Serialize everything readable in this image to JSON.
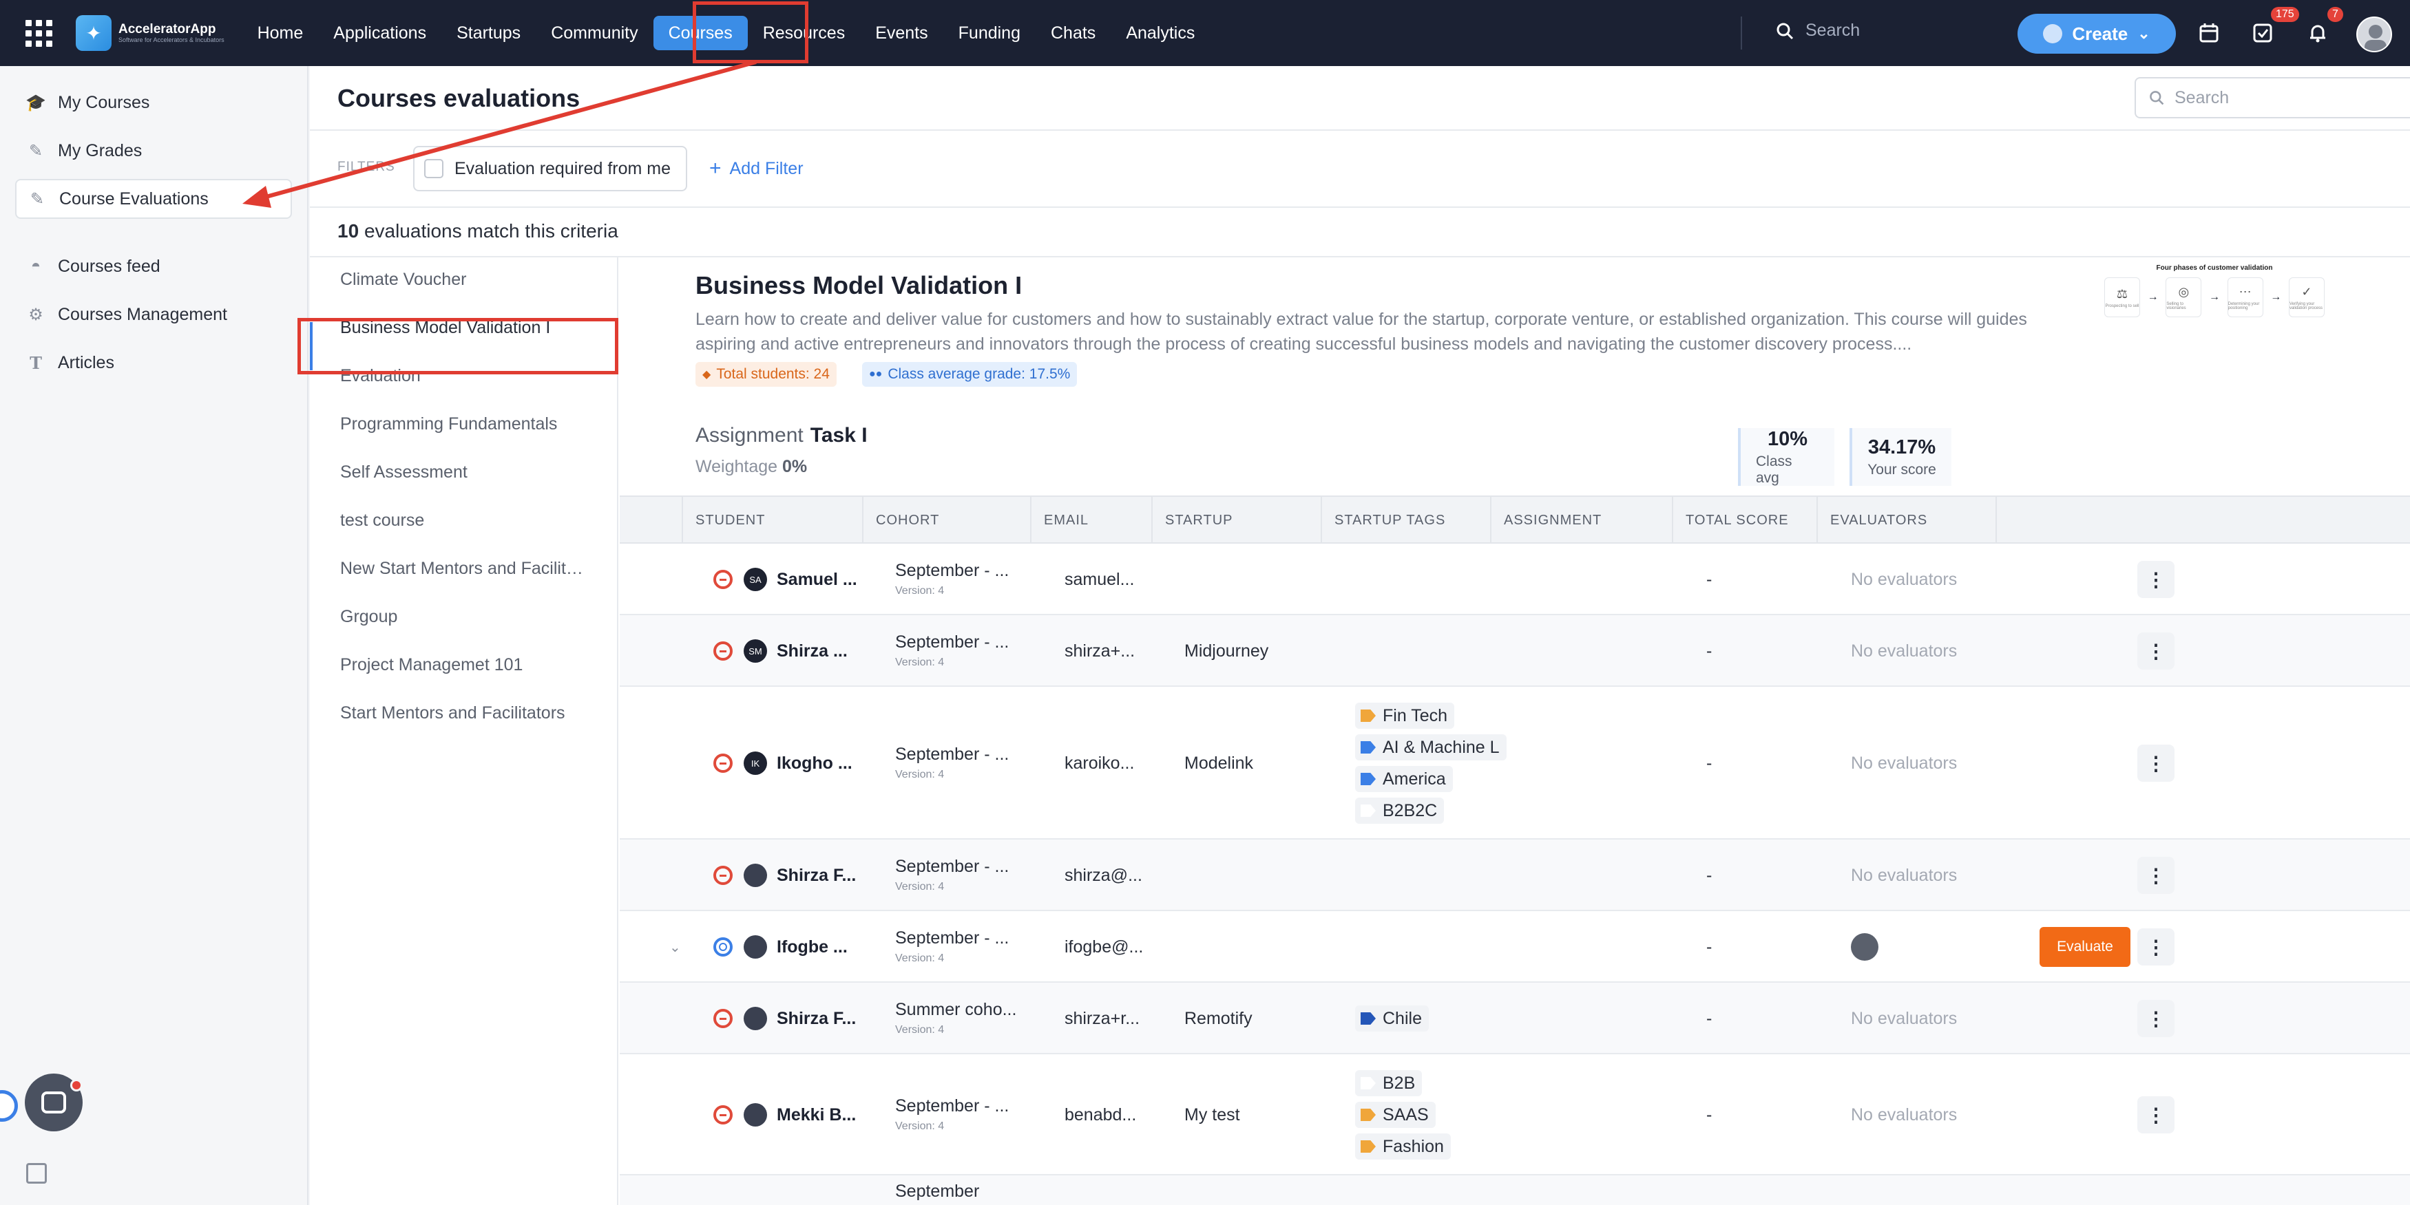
{
  "topbar": {
    "logo_name": "AcceleratorApp",
    "logo_sub": "Software for Accelerators & Incubators",
    "nav": [
      "Home",
      "Applications",
      "Startups",
      "Community",
      "Courses",
      "Resources",
      "Events",
      "Funding",
      "Chats",
      "Analytics"
    ],
    "active_nav": "Courses",
    "search_placeholder": "Search",
    "create_label": "Create",
    "tasks_badge": "175",
    "notifications_badge": "7"
  },
  "sidebar": {
    "items": [
      {
        "label": "My Courses",
        "icon": "courses-icon"
      },
      {
        "label": "My Grades",
        "icon": "grades-icon"
      },
      {
        "label": "Course Evaluations",
        "icon": "evaluations-icon"
      },
      {
        "label": "Courses feed",
        "icon": "feed-icon"
      },
      {
        "label": "Courses Management",
        "icon": "gear-icon"
      },
      {
        "label": "Articles",
        "icon": "text-icon"
      }
    ],
    "selected": "Course Evaluations"
  },
  "main": {
    "title": "Courses evaluations",
    "search_placeholder": "Search",
    "filters_label": "FILTERS",
    "filter_chip": "Evaluation required from me",
    "add_filter": "Add Filter",
    "match_count": "10",
    "match_text": "evaluations match this criteria"
  },
  "courses": [
    "Climate Voucher",
    "Business Model Validation I",
    "Evaluation",
    "Programming Fundamentals",
    "Self Assessment",
    "test course",
    "New Start Mentors and Facilitators",
    "Grgoup",
    "Project Managemet 101",
    "Start Mentors and Facilitators"
  ],
  "course": {
    "title": "Business Model Validation I",
    "description": "Learn how to create and deliver value for customers and how to sustainably extract value for the startup, corporate venture, or established organization. This course will guides aspiring and active entrepreneurs and innovators through the process of creating successful business models and navigating the customer discovery process....",
    "total_students": "Total students: 24",
    "class_avg_grade": "Class average grade: 17.5%",
    "thumb_title": "Four phases of customer validation",
    "thumb_steps": [
      "Prospecting to sell",
      "Selling to visionaries",
      "Determining your positioning",
      "Verifying your validation process"
    ]
  },
  "assignment": {
    "label": "Assignment",
    "name": "Task I",
    "weightage_label": "Weightage",
    "weightage": "0%",
    "class_avg": "10%",
    "class_avg_label": "Class avg",
    "your_score": "34.17%",
    "your_score_label": "Your score"
  },
  "table": {
    "headers": [
      "STUDENT",
      "COHORT",
      "EMAIL",
      "STARTUP",
      "STARTUP TAGS",
      "ASSIGNMENT",
      "TOTAL SCORE",
      "EVALUATORS"
    ],
    "no_evaluators": "No evaluators",
    "evaluate_label": "Evaluate",
    "rows": [
      {
        "initials": "SA",
        "name": "Samuel ...",
        "cohort": "September - ...",
        "version": "Version: 4",
        "email": "samuel...",
        "startup": "",
        "tags": [],
        "score": "-",
        "evaluators": "No evaluators",
        "status": "red"
      },
      {
        "initials": "SM",
        "name": "Shirza ...",
        "cohort": "September - ...",
        "version": "Version: 4",
        "email": "shirza+...",
        "startup": "Midjourney",
        "tags": [],
        "score": "-",
        "evaluators": "No evaluators",
        "status": "red"
      },
      {
        "initials": "IK",
        "name": "Ikogho ...",
        "cohort": "September - ...",
        "version": "Version: 4",
        "email": "karoiko...",
        "startup": "Modelink",
        "tags": [
          {
            "label": "Fin Tech",
            "color": "#f0a63a"
          },
          {
            "label": "AI & Machine L",
            "color": "#3b7fe6"
          },
          {
            "label": "America",
            "color": "#3b7fe6"
          },
          {
            "label": "B2B2C",
            "color": "#ffffff"
          }
        ],
        "score": "-",
        "evaluators": "No evaluators",
        "status": "red"
      },
      {
        "initials": "",
        "name": "Shirza F...",
        "cohort": "September - ...",
        "version": "Version: 4",
        "email": "shirza@...",
        "startup": "",
        "tags": [],
        "score": "-",
        "evaluators": "No evaluators",
        "status": "red"
      },
      {
        "initials": "",
        "name": "Ifogbe ...",
        "cohort": "September - ...",
        "version": "Version: 4",
        "email": "ifogbe@...",
        "startup": "",
        "tags": [],
        "score": "-",
        "evaluators": "",
        "status": "blue"
      },
      {
        "initials": "",
        "name": "Shirza F...",
        "cohort": "Summer coho...",
        "version": "Version: 4",
        "email": "shirza+r...",
        "startup": "Remotify",
        "tags": [
          {
            "label": "Chile",
            "color": "#2456b8"
          }
        ],
        "score": "-",
        "evaluators": "No evaluators",
        "status": "red"
      },
      {
        "initials": "",
        "name": "Mekki B...",
        "cohort": "September - ...",
        "version": "Version: 4",
        "email": "benabd...",
        "startup": "My test",
        "tags": [
          {
            "label": "B2B",
            "color": "#ffffff"
          },
          {
            "label": "SAAS",
            "color": "#f0a63a"
          },
          {
            "label": "Fashion",
            "color": "#f0a63a"
          }
        ],
        "score": "-",
        "evaluators": "No evaluators",
        "status": "red"
      },
      {
        "initials": "",
        "name": "",
        "cohort": "September",
        "version": "",
        "email": "",
        "startup": "",
        "tags": [],
        "score": "",
        "evaluators": "",
        "status": ""
      }
    ]
  },
  "colors": {
    "accent": "#3b7fe6",
    "nav_bg": "#1b2133",
    "evaluate": "#f26a16",
    "annotation": "#e03c31"
  }
}
